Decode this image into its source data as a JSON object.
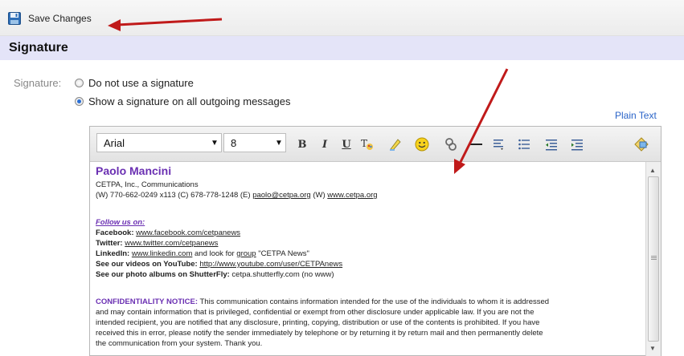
{
  "toolbar": {
    "save_label": "Save Changes",
    "save_icon": "floppy-disk-icon"
  },
  "section": {
    "title": "Signature"
  },
  "signature_option": {
    "label": "Signature:",
    "options": [
      {
        "label": "Do not use a signature",
        "checked": false
      },
      {
        "label": "Show a signature on all outgoing messages",
        "checked": true
      }
    ]
  },
  "plain_text_link": "Plain Text",
  "editor_toolbar": {
    "font_family": "Arial",
    "font_size": "8",
    "buttons": [
      "bold",
      "italic",
      "underline",
      "text-color",
      "highlight",
      "emoji",
      "link",
      "horizontal-rule",
      "align",
      "bullet-list",
      "outdent",
      "indent",
      "image"
    ]
  },
  "signature_content": {
    "name": "Paolo Mancini",
    "company": "CETPA, Inc., Communications",
    "contact_prefix": "(W) 770-662-0249 x113 (C) 678-778-1248 (E) ",
    "email": "paolo@cetpa.org",
    "contact_mid": " (W) ",
    "website": "www.cetpa.org",
    "follow_heading": "Follow us on:",
    "facebook_label": "Facebook:",
    "facebook_url": "www.facebook.com/cetpanews",
    "twitter_label": "Twitter:",
    "twitter_url": "www.twitter.com/cetpanews",
    "linkedin_label": "LinkedIn:",
    "linkedin_url": "www.linkedin.com",
    "linkedin_mid": " and look for ",
    "linkedin_group_word": "group",
    "linkedin_group_name": " \"CETPA News\"",
    "youtube_label": "See our videos on YouTube:",
    "youtube_url": "http://www.youtube.com/user/CETPAnews",
    "shutterfly_label": "See our photo albums on ShutterFly:",
    "shutterfly_text": " cetpa.shutterfly.com (no www)",
    "conf_heading": "CONFIDENTIALITY NOTICE:",
    "conf_line1": " This communication contains information intended for the use of the individuals to whom it is addressed",
    "conf_line2": "and may contain information that is privileged, confidential or exempt from other disclosure under applicable law. If you are not the",
    "conf_line3": "intended recipient, you are notified that any disclosure, printing, copying, distribution or use of the contents is prohibited. If you have",
    "conf_line4": "received this in error, please notify the sender immediately by telephone or by returning it by return mail and then permanently delete",
    "conf_line5": "the communication from your system. Thank you."
  },
  "colors": {
    "accent_purple": "#6a2fb2",
    "link_blue": "#2a64c8",
    "annotation_arrow": "#c01a1a",
    "section_bg": "#e4e4f8"
  }
}
